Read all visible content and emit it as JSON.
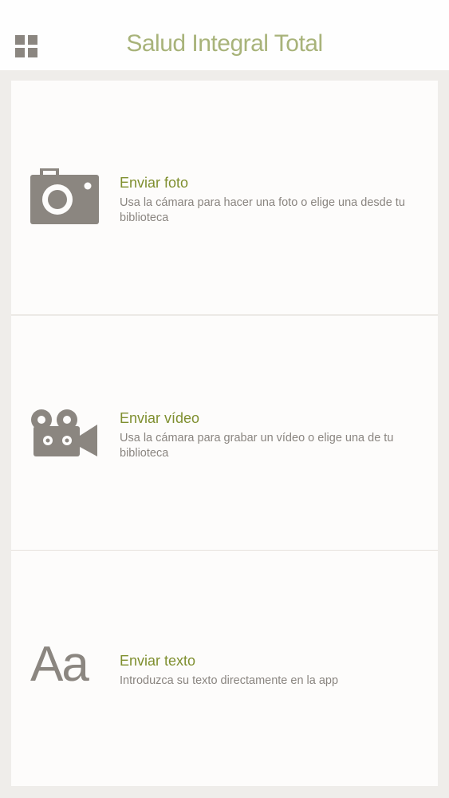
{
  "header": {
    "title": "Salud Integral Total",
    "menu_icon": "grid-icon"
  },
  "options": [
    {
      "title": "Enviar foto",
      "description": "Usa la cámara para hacer una foto o elige una desde tu biblioteca",
      "icon": "camera-icon"
    },
    {
      "title": "Enviar vídeo",
      "description": "Usa la cámara para grabar un vídeo o elige una de tu biblioteca",
      "icon": "video-camera-icon"
    },
    {
      "title": "Enviar texto",
      "description": "Introduzca su texto directamente en la app",
      "icon": "text-icon",
      "icon_glyph": "Aa"
    }
  ],
  "colors": {
    "accent_title": "#a8b37a",
    "option_title": "#7f8f2f",
    "icon": "#8b8680",
    "background": "#efedea"
  }
}
